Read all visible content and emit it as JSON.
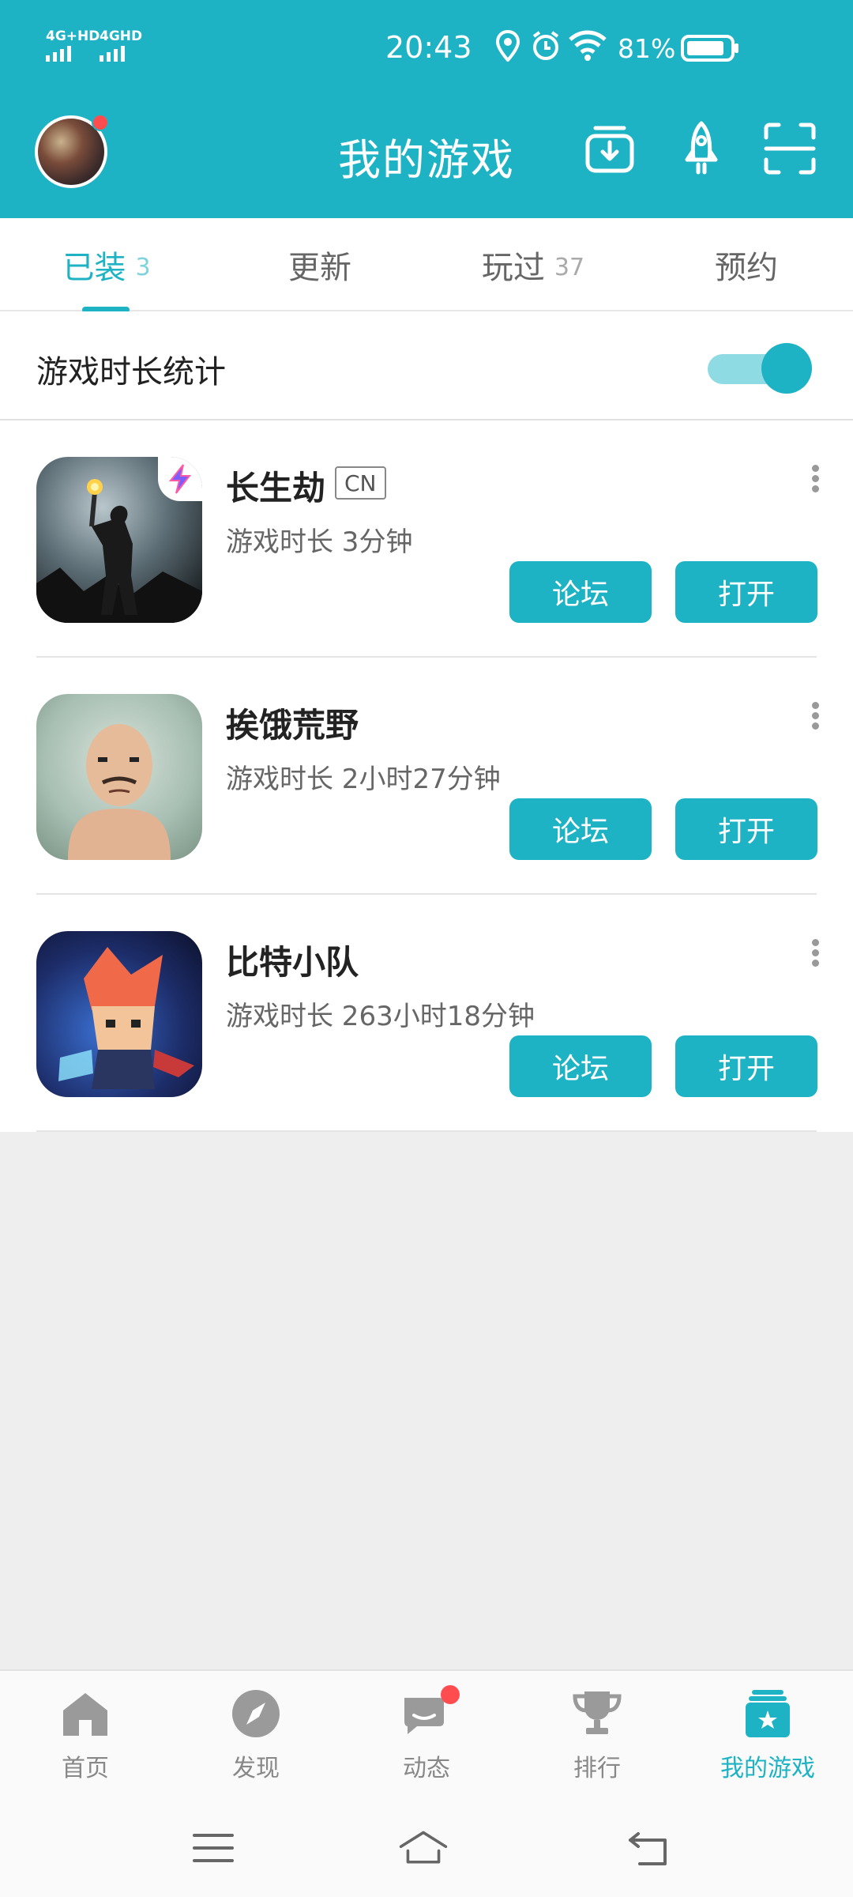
{
  "status_bar": {
    "signal_1": "4G+HD",
    "signal_2": "4GHD",
    "time": "20:43",
    "battery_pct": "81%"
  },
  "header": {
    "title": "我的游戏",
    "icons": [
      "download-icon",
      "rocket-icon",
      "scan-icon"
    ]
  },
  "tabs": [
    {
      "label": "已装",
      "count": "3",
      "active": true
    },
    {
      "label": "更新",
      "count": "",
      "active": false
    },
    {
      "label": "玩过",
      "count": "37",
      "active": false
    },
    {
      "label": "预约",
      "count": "",
      "active": false
    }
  ],
  "stats": {
    "label": "游戏时长统计",
    "enabled": true
  },
  "games": [
    {
      "name": "长生劫",
      "tag": "CN",
      "play_time": "游戏时长 3分钟",
      "forum_label": "论坛",
      "open_label": "打开"
    },
    {
      "name": "挨饿荒野",
      "tag": "",
      "play_time": "游戏时长 2小时27分钟",
      "forum_label": "论坛",
      "open_label": "打开"
    },
    {
      "name": "比特小队",
      "tag": "",
      "play_time": "游戏时长 263小时18分钟",
      "forum_label": "论坛",
      "open_label": "打开"
    }
  ],
  "bottom_nav": [
    {
      "label": "首页",
      "icon": "home-icon"
    },
    {
      "label": "发现",
      "icon": "compass-icon"
    },
    {
      "label": "动态",
      "icon": "chat-icon"
    },
    {
      "label": "排行",
      "icon": "trophy-icon"
    },
    {
      "label": "我的游戏",
      "icon": "my-games-icon"
    }
  ],
  "colors": {
    "accent": "#1db3c4",
    "badge_red": "#ff4d4f"
  }
}
